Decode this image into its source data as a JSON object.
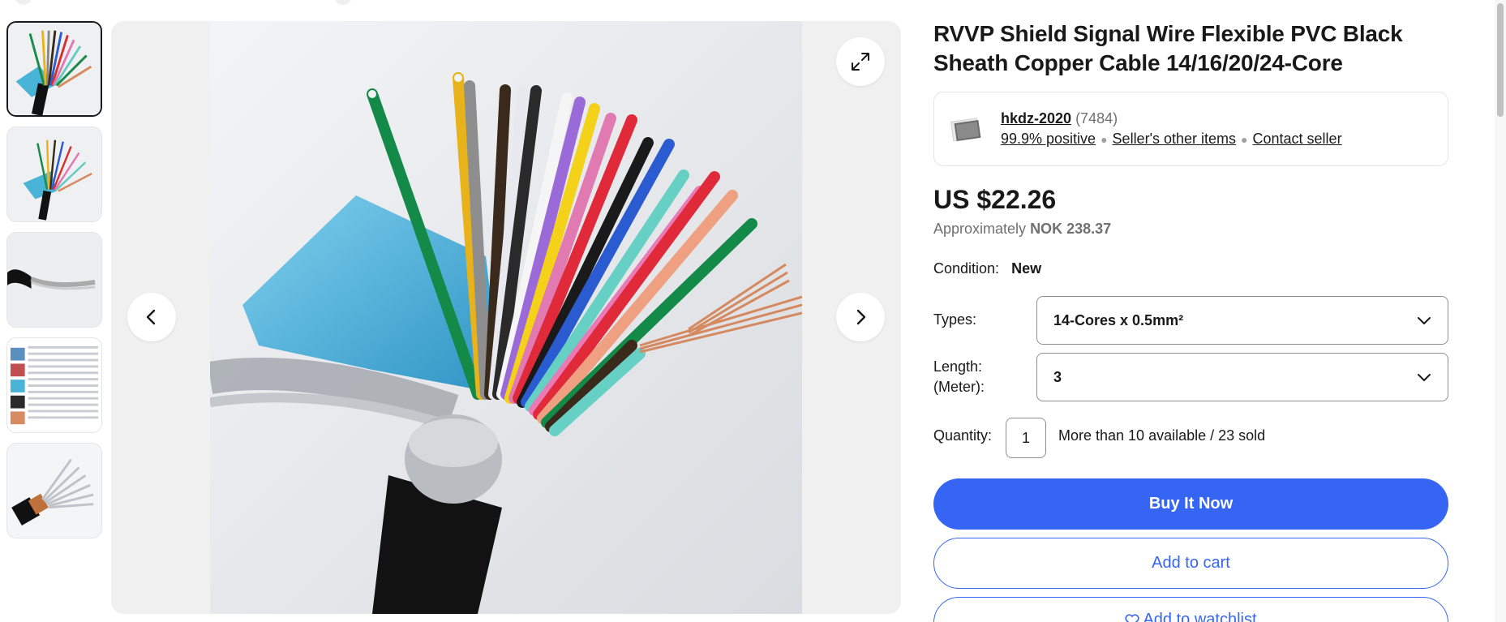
{
  "product": {
    "title": "RVVP Shield Signal Wire Flexible PVC Black Sheath Copper Cable 14/16/20/24-Core"
  },
  "seller": {
    "name": "hkdz-2020",
    "feedback_count": "(7484)",
    "positive": "99.9% positive",
    "other_items": "Seller's other items",
    "contact": "Contact seller"
  },
  "pricing": {
    "price": "US $22.26",
    "approx_prefix": "Approximately",
    "approx_value": "NOK 238.37"
  },
  "condition": {
    "label": "Condition:",
    "value": "New"
  },
  "options": {
    "types_label": "Types:",
    "types_value": "14-Cores x 0.5mm²",
    "length_label_1": "Length:",
    "length_label_2": "(Meter):",
    "length_value": "3"
  },
  "quantity": {
    "label": "Quantity:",
    "value": "1",
    "availability": "More than 10 available / 23 sold"
  },
  "actions": {
    "buy_now": "Buy It Now",
    "add_to_cart": "Add to cart",
    "watchlist": "Add to watchlist"
  },
  "gallery": {
    "thumbnail_count": 5,
    "selected_index": 0
  },
  "colors": {
    "accent": "#3665f3",
    "text": "#191919",
    "muted": "#707070"
  }
}
